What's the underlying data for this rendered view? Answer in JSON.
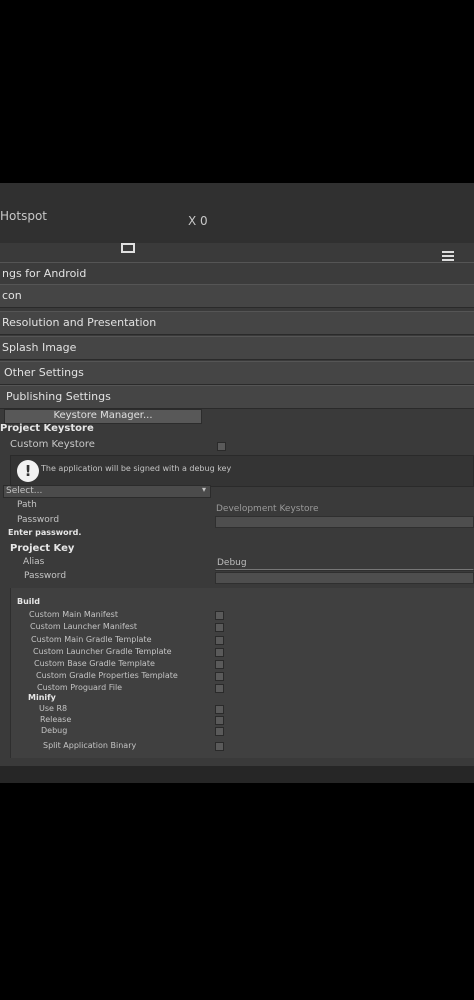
{
  "header": {
    "tab_title": "Hotspot",
    "xo_label": "X 0"
  },
  "sections": {
    "settings_for": "ngs for Android",
    "icon": "con",
    "resolution": "Resolution and Presentation",
    "splash": "Splash Image",
    "other": "Other Settings",
    "publishing": "Publishing Settings"
  },
  "keystore": {
    "manager_button": "Keystore Manager...",
    "project_keystore": "Project Keystore",
    "custom_keystore": "Custom Keystore",
    "info_message": "The application will be signed with a debug key",
    "select_label": "Select...",
    "path_label": "Path",
    "path_value": "Development Keystore",
    "password_label": "Password",
    "enter_password": "Enter password."
  },
  "project_key": {
    "title": "Project Key",
    "alias_label": "Alias",
    "alias_value": "Debug",
    "password_label": "Password"
  },
  "build": {
    "title": "Build",
    "items": [
      "Custom Main Manifest",
      "Custom Launcher Manifest",
      "Custom Main Gradle Template",
      "Custom Launcher Gradle Template",
      "Custom Base Gradle Template",
      "Custom Gradle Properties Template",
      "Custom Proguard File"
    ],
    "minify_title": "Minify",
    "minify_items": [
      "Use R8",
      "Release",
      "Debug"
    ],
    "split_binary": "Split Application Binary"
  }
}
